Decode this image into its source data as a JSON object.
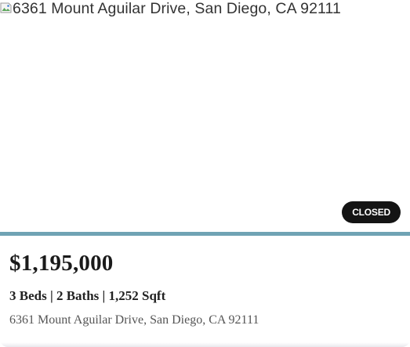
{
  "listing": {
    "image_alt": "6361 Mount Aguilar Drive, San Diego, CA 92111",
    "status": "CLOSED",
    "price": "$1,195,000",
    "specs": "3 Beds | 2 Baths | 1,252 Sqft",
    "address": "6361 Mount Aguilar Drive, San Diego, CA 92111"
  },
  "colors": {
    "accent_bar": "#6fa3b4",
    "badge_background": "#141414",
    "badge_text": "#ffffff"
  },
  "icons": {
    "broken_image": "broken-image-icon"
  }
}
